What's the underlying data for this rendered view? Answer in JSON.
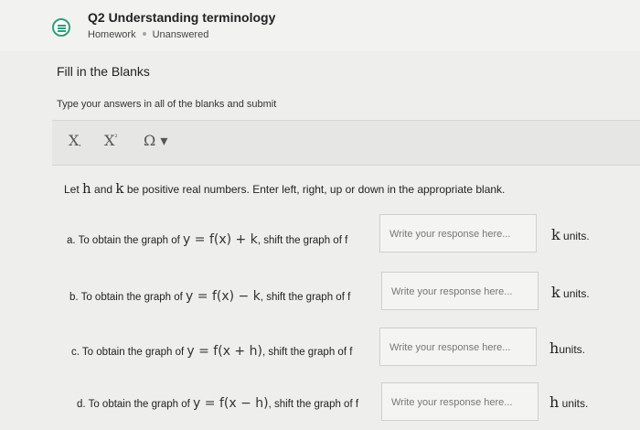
{
  "header": {
    "title": "Q2 Understanding terminology",
    "type": "Homework",
    "status": "Unanswered"
  },
  "section": {
    "title": "Fill in the Blanks",
    "instructions": "Type your answers in all of the blanks and submit"
  },
  "toolbar": {
    "subscript": "X",
    "subscript_mark": ",",
    "superscript": "X",
    "superscript_mark": "²",
    "special": "Ω ▾"
  },
  "prompt": {
    "p1": "Let ",
    "h": "h",
    "p2": " and ",
    "k": "k",
    "p3": " be positive real numbers. Enter left, right, up or down in the appropriate blank."
  },
  "rows": [
    {
      "lead": "a. To obtain the graph of ",
      "math": "y = f(x) + k",
      "tail": ", shift the graph of f",
      "placeholder": "Write your response here...",
      "var": "k",
      "unit": " units."
    },
    {
      "lead": "b. To obtain the graph of ",
      "math": "y = f(x) − k",
      "tail": ", shift the graph of f",
      "placeholder": "Write your response here...",
      "var": "k",
      "unit": " units."
    },
    {
      "lead": "c. To obtain the graph of ",
      "math": "y = f(x + h)",
      "tail": ", shift the graph of f",
      "placeholder": "Write your response here...",
      "var": "h",
      "unit": "units."
    },
    {
      "lead": "d. To obtain the graph of ",
      "math": "y = f(x − h)",
      "tail": ", shift the graph of f",
      "placeholder": "Write your response here...",
      "var": "h",
      "unit": " units."
    }
  ]
}
